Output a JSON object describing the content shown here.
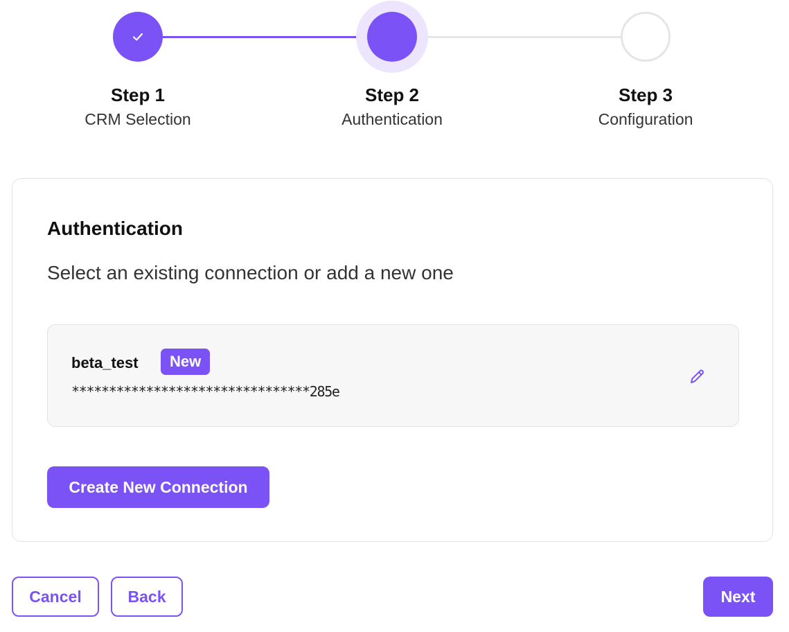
{
  "stepper": {
    "steps": [
      {
        "title": "Step 1",
        "subtitle": "CRM Selection",
        "state": "completed"
      },
      {
        "title": "Step 2",
        "subtitle": "Authentication",
        "state": "active"
      },
      {
        "title": "Step 3",
        "subtitle": "Configuration",
        "state": "pending"
      }
    ]
  },
  "card": {
    "title": "Authentication",
    "subtitle": "Select an existing connection or add a new one",
    "connection": {
      "name": "beta_test",
      "badge": "New",
      "key": "********************************285e"
    },
    "create_label": "Create New Connection"
  },
  "footer": {
    "cancel_label": "Cancel",
    "back_label": "Back",
    "next_label": "Next"
  },
  "colors": {
    "accent": "#7b52f5",
    "accent_soft": "#ece5fd",
    "border": "#e2e2e2",
    "panel_bg": "#f7f7f7"
  }
}
